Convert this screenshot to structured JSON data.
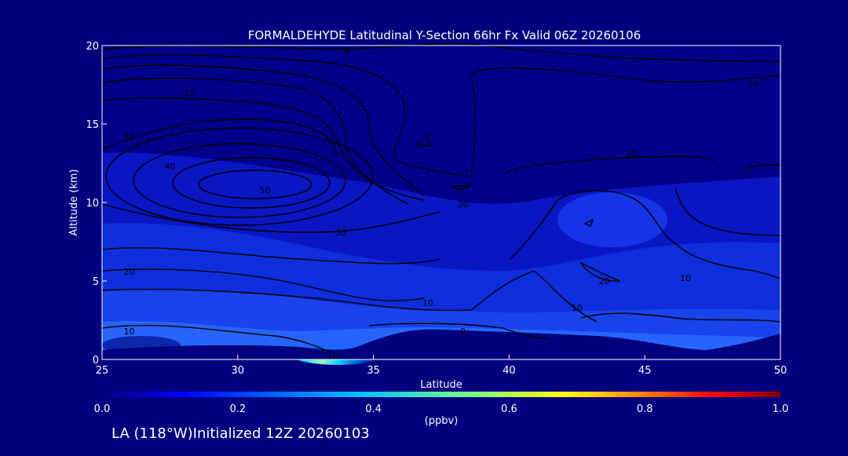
{
  "chart_data": {
    "type": "contour",
    "title": "FORMALDEHYDE Latitudinal Y-Section 66hr  Fx Valid 06Z 20260106",
    "xlabel": "Latitude",
    "ylabel": "Altitude (km)",
    "xlim": [
      25,
      50
    ],
    "ylim": [
      0,
      20
    ],
    "x_ticks": [
      "25",
      "30",
      "35",
      "40",
      "45",
      "50"
    ],
    "y_ticks": [
      "0",
      "5",
      "10",
      "15",
      "20"
    ],
    "colorbar": {
      "label": "(ppbv)",
      "ticks": [
        "0.0",
        "0.2",
        "0.4",
        "0.6",
        "0.8",
        "1.0"
      ],
      "range": [
        0.0,
        1.0
      ],
      "colors": [
        "#00007f",
        "#0000ff",
        "#00bfff",
        "#7fff7f",
        "#ffff00",
        "#ff7f00",
        "#ff0000",
        "#7f0000"
      ]
    },
    "contour_labels": [
      {
        "text": "50",
        "lat": 31.0,
        "alt": 10.8
      },
      {
        "text": "40",
        "lat": 27.5,
        "alt": 12.3
      },
      {
        "text": "30",
        "lat": 28.2,
        "alt": 17.0
      },
      {
        "text": "30",
        "lat": 33.8,
        "alt": 8.1
      },
      {
        "text": "20",
        "lat": 26.0,
        "alt": 5.6
      },
      {
        "text": "20",
        "lat": 38.3,
        "alt": 9.9
      },
      {
        "text": "20",
        "lat": 43.5,
        "alt": 5.0
      },
      {
        "text": "10",
        "lat": 26.0,
        "alt": 14.2
      },
      {
        "text": "10",
        "lat": 26.0,
        "alt": 1.8
      },
      {
        "text": "10",
        "lat": 33.5,
        "alt": 0.2
      },
      {
        "text": "10",
        "lat": 37.0,
        "alt": 3.6
      },
      {
        "text": "10",
        "lat": 42.5,
        "alt": 3.3
      },
      {
        "text": "10",
        "lat": 46.5,
        "alt": 5.2
      },
      {
        "text": "10",
        "lat": 49.0,
        "alt": 17.6
      },
      {
        "text": "10",
        "lat": 44.5,
        "alt": 13.1
      },
      {
        "text": "9",
        "lat": 34.0,
        "alt": 19.6
      },
      {
        "text": "0",
        "lat": 38.3,
        "alt": 1.8
      }
    ],
    "footer": "LA (118°W)Initialized 12Z 20260103"
  }
}
